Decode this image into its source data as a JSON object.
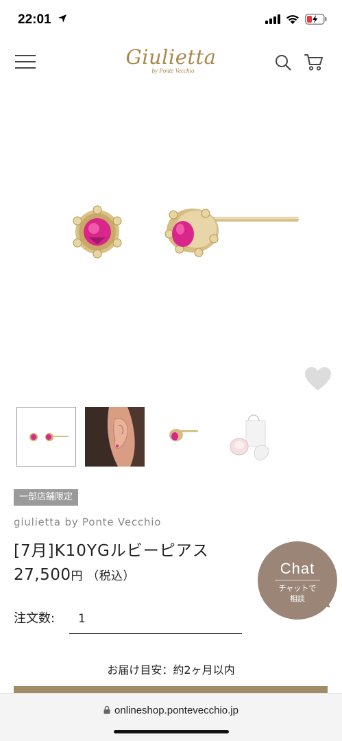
{
  "status_bar": {
    "time": "22:01",
    "icons": [
      "location-arrow-icon",
      "cellular-signal-icon",
      "wifi-icon",
      "battery-charging-icon"
    ]
  },
  "header": {
    "logo_main": "Giulietta",
    "logo_sub": "by Ponte Vecchio",
    "icons": [
      "hamburger-menu-icon",
      "search-icon",
      "cart-icon"
    ]
  },
  "product": {
    "badge": "一部店舗限定",
    "brand": "giulietta by Ponte Vecchio",
    "title": "[7月]K10YGルビーピアス",
    "price_value": "27,500",
    "price_unit": "円",
    "price_tax": "（税込）",
    "quantity_label": "注文数:",
    "quantity_value": "1",
    "delivery": "お届け目安：約2ヶ月以内"
  },
  "gallery": {
    "thumbnails": [
      "earrings-pair",
      "earring-on-ear",
      "earring-side",
      "gift-packaging"
    ],
    "active_index": 0
  },
  "chat": {
    "title": "Chat",
    "sub_line1": "チャットで",
    "sub_line2": "相談"
  },
  "browser": {
    "url": "onlineshop.pontevecchio.jp"
  },
  "colors": {
    "brand_gold": "#a8874a",
    "chat_bg": "#9b8577",
    "badge_bg": "#9a9a9a",
    "cart_bar": "#a08c66"
  }
}
